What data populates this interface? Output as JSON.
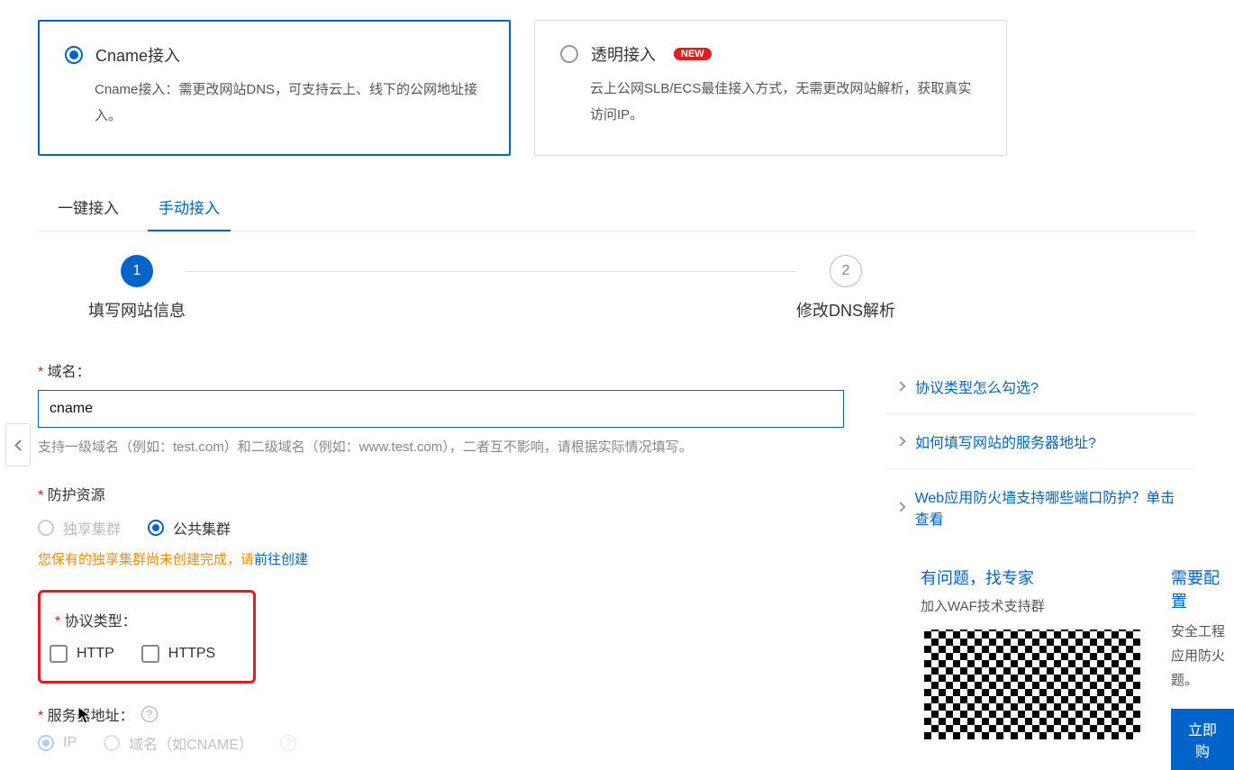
{
  "modes": {
    "cname": {
      "title": "Cname接入",
      "desc": "Cname接入：需更改网站DNS，可支持云上、线下的公网地址接入。"
    },
    "transparent": {
      "title": "透明接入",
      "badge": "NEW",
      "desc": "云上公网SLB/ECS最佳接入方式，无需更改网站解析，获取真实访问IP。"
    }
  },
  "tabs": {
    "auto": "一键接入",
    "manual": "手动接入"
  },
  "steps": {
    "s1": {
      "num": "1",
      "title": "填写网站信息"
    },
    "s2": {
      "num": "2",
      "title": "修改DNS解析"
    }
  },
  "form": {
    "domain_label": "域名：",
    "domain_value": "cname",
    "domain_hint": "支持一级域名（例如：test.com）和二级域名（例如：www.test.com），二者互不影响，请根据实际情况填写。",
    "resource_label": "防护资源",
    "resource_private": "独享集群",
    "resource_public": "公共集群",
    "resource_warn_a": "您保有的独享集群尚未创建完成，请",
    "resource_warn_link": "前往创建",
    "protocol_label": "协议类型：",
    "protocol_http": "HTTP",
    "protocol_https": "HTTPS",
    "server_label": "服务器地址：",
    "server_ip": "IP",
    "server_cname": "域名（如CNAME）"
  },
  "help": {
    "l1": "协议类型怎么勾选?",
    "l2": "如何填写网站的服务器地址?",
    "l3": "Web应用防火墙支持哪些端口防护？单击查看"
  },
  "panels": {
    "expert_title": "有问题，找专家",
    "expert_sub": "加入WAF技术支持群",
    "need_title": "需要配置",
    "need_body1": "安全工程",
    "need_body2": "应用防火",
    "need_body3": "题。",
    "need_btn": "立即购"
  }
}
